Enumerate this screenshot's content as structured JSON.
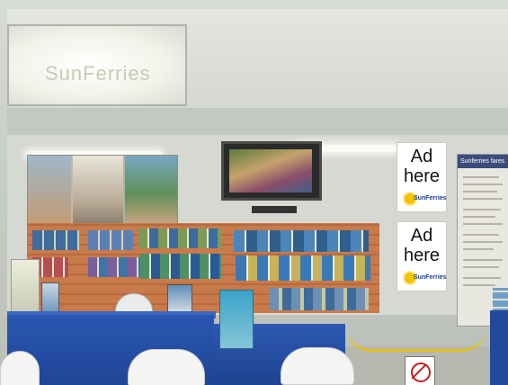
{
  "scene": {
    "description": "",
    "overhead_sign_text": "SunFerries",
    "ads": [
      {
        "line1": "Ad",
        "line2": "here",
        "logo_text": "SunFerries"
      },
      {
        "line1": "Ad",
        "line2": "here",
        "logo_text": "SunFerries"
      }
    ],
    "info_board_header": "Sunferries fares",
    "colors": {
      "counter_blue": "#2a57b0",
      "pegboard": "#c97a4a",
      "ad_background": "#ffffff",
      "rope_yellow": "#e0c21b"
    }
  }
}
